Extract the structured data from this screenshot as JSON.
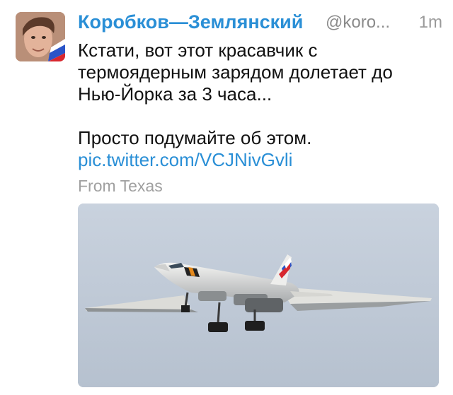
{
  "tweet": {
    "author_name": "Коробков—Землянский",
    "author_handle": "@koro...",
    "time": "1m",
    "text_lines": [
      "Кстати, вот этот красавчик с",
      "термоядерным зарядом долетает до",
      "Нью-Йорка за 3 часа...",
      "Просто подумайте об этом."
    ],
    "link": "pic.twitter.com/VCJNivGvli",
    "location": "From Texas"
  },
  "colors": {
    "accent": "#2a8fd6",
    "muted": "#9a9a9a",
    "text": "#111111"
  },
  "icons": {
    "avatar": "user-avatar-photo",
    "media": "aircraft-photo"
  }
}
